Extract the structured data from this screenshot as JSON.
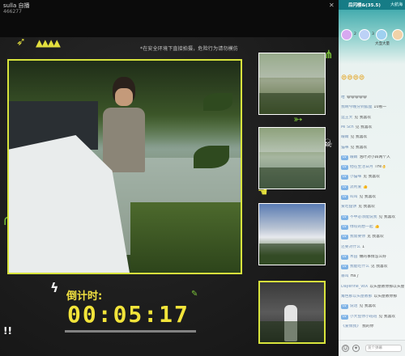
{
  "stream": {
    "streamer_name": "sulla 自播",
    "room_id": "466277",
    "notice": "*在安全环境下直接拍摄，危险行为请勿模仿",
    "countdown_label": "倒计时:",
    "countdown_time": "00:05:17"
  },
  "chat": {
    "title": "后闪楼&(35.5)",
    "top_link": "大航海",
    "ranks": [
      {
        "name": "2",
        "badge": "#d7a9f0"
      },
      {
        "name": "3",
        "badge": "#bcd1f6"
      },
      {
        "name": "大壶大量",
        "badge": "#9fd0f0"
      },
      {
        "name": "1",
        "badge": "#f0d2a9"
      }
    ],
    "gift_text": "😄😄😄😄",
    "messages": [
      {
        "lv": "",
        "user": "哈",
        "text": "😄😄😄😄😄"
      },
      {
        "lv": "",
        "user": "我啊今晚分到狐狸",
        "text": "10看一"
      },
      {
        "lv": "",
        "user": "运王大",
        "text": "见 我喜欢"
      },
      {
        "lv": "",
        "user": "Ml Sch",
        "text": "见 我喜欢"
      },
      {
        "lv": "",
        "user": "眼睛",
        "text": "见 我喜欢"
      },
      {
        "lv": "",
        "user": "猫咪",
        "text": "见 我喜欢"
      },
      {
        "lv": "LV",
        "user": "眼睛",
        "text": "泡叶对小四两个人"
      },
      {
        "lv": "LV",
        "user": "他在生活日月",
        "text": "TFe👌"
      },
      {
        "lv": "LV",
        "user": "小猫咪",
        "text": "见 我喜欢"
      },
      {
        "lv": "LV",
        "user": "流利爱",
        "text": "👍"
      },
      {
        "lv": "LV",
        "user": "叫叫",
        "text": "见 我喜欢"
      },
      {
        "lv": "",
        "user": "爱吃甜饼",
        "text": "见 我喜欢"
      },
      {
        "lv": "LV",
        "user": "不中必须能说我",
        "text": "见 我喜欢"
      },
      {
        "lv": "LV",
        "user": "绿咬的想一起",
        "text": "👍"
      },
      {
        "lv": "LV",
        "user": "我需要你",
        "text": "见 我喜欢"
      },
      {
        "lv": "",
        "user": "还要对什么",
        "text": "1"
      },
      {
        "lv": "LV",
        "user": "木田",
        "text": "做的事情怎么好"
      },
      {
        "lv": "LV",
        "user": "我能吃什么",
        "text": "见 我喜欢"
      },
      {
        "lv": "",
        "user": "暴叫",
        "text": "Ha了"
      },
      {
        "lv": "",
        "user": "Dayerine_VoX",
        "text": "以头屋教你那以头屋教"
      },
      {
        "lv": "",
        "user": "角色那以头屋教那",
        "text": "以头屋教你那"
      },
      {
        "lv": "LV",
        "user": "说话",
        "text": "见 我喜欢"
      },
      {
        "lv": "LV",
        "user": "小大鱼你小班班",
        "text": "见 我喜欢"
      },
      {
        "lv": "",
        "user": "《爱情我》",
        "text": "我的你"
      }
    ],
    "input_placeholder": "发个弹幕"
  }
}
